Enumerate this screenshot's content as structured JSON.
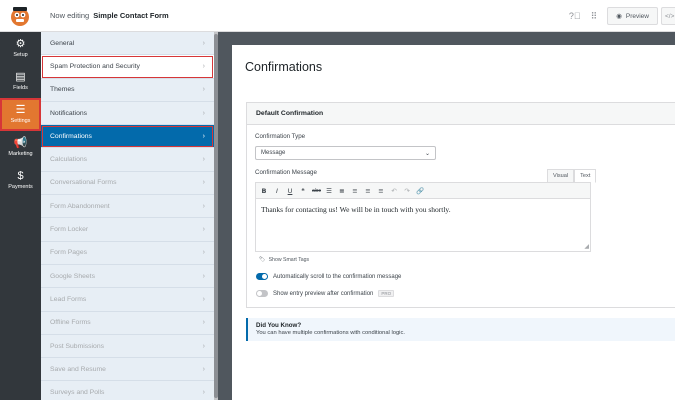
{
  "header": {
    "editing_label": "Now editing",
    "form_name": "Simple Contact Form",
    "preview_label": "Preview",
    "embed_glyph": "</>"
  },
  "iconbar": {
    "items": [
      {
        "label": "Setup",
        "icon": "gear-icon"
      },
      {
        "label": "Fields",
        "icon": "fields-icon"
      },
      {
        "label": "Settings",
        "icon": "sliders-icon"
      },
      {
        "label": "Marketing",
        "icon": "megaphone-icon"
      },
      {
        "label": "Payments",
        "icon": "dollar-icon"
      }
    ]
  },
  "panel": {
    "items": [
      {
        "label": "General"
      },
      {
        "label": "Spam Protection and Security"
      },
      {
        "label": "Themes"
      },
      {
        "label": "Notifications"
      },
      {
        "label": "Confirmations"
      },
      {
        "label": "Calculations"
      },
      {
        "label": "Conversational Forms"
      },
      {
        "label": "Form Abandonment"
      },
      {
        "label": "Form Locker"
      },
      {
        "label": "Form Pages"
      },
      {
        "label": "Google Sheets"
      },
      {
        "label": "Lead Forms"
      },
      {
        "label": "Offline Forms"
      },
      {
        "label": "Post Submissions"
      },
      {
        "label": "Save and Resume"
      },
      {
        "label": "Surveys and Polls"
      }
    ],
    "chevron": "›"
  },
  "main": {
    "title": "Confirmations",
    "card": {
      "header": "Default Confirmation",
      "type_label": "Confirmation Type",
      "type_value": "Message",
      "message_label": "Confirmation Message",
      "tab_visual": "Visual",
      "tab_text": "Text",
      "message_text": "Thanks for contacting us! We will be in touch with you shortly.",
      "smart_tags": "Show Smart Tags",
      "toggle_scroll": "Automatically scroll to the confirmation message",
      "toggle_preview": "Show entry preview after confirmation",
      "pro_badge": "PRO"
    },
    "notice": {
      "title": "Did You Know?",
      "text": "You can have multiple confirmations with conditional logic."
    }
  },
  "colors": {
    "accent": "#036aab",
    "settings_active": "#e27730",
    "highlight_border": "#d63638"
  }
}
